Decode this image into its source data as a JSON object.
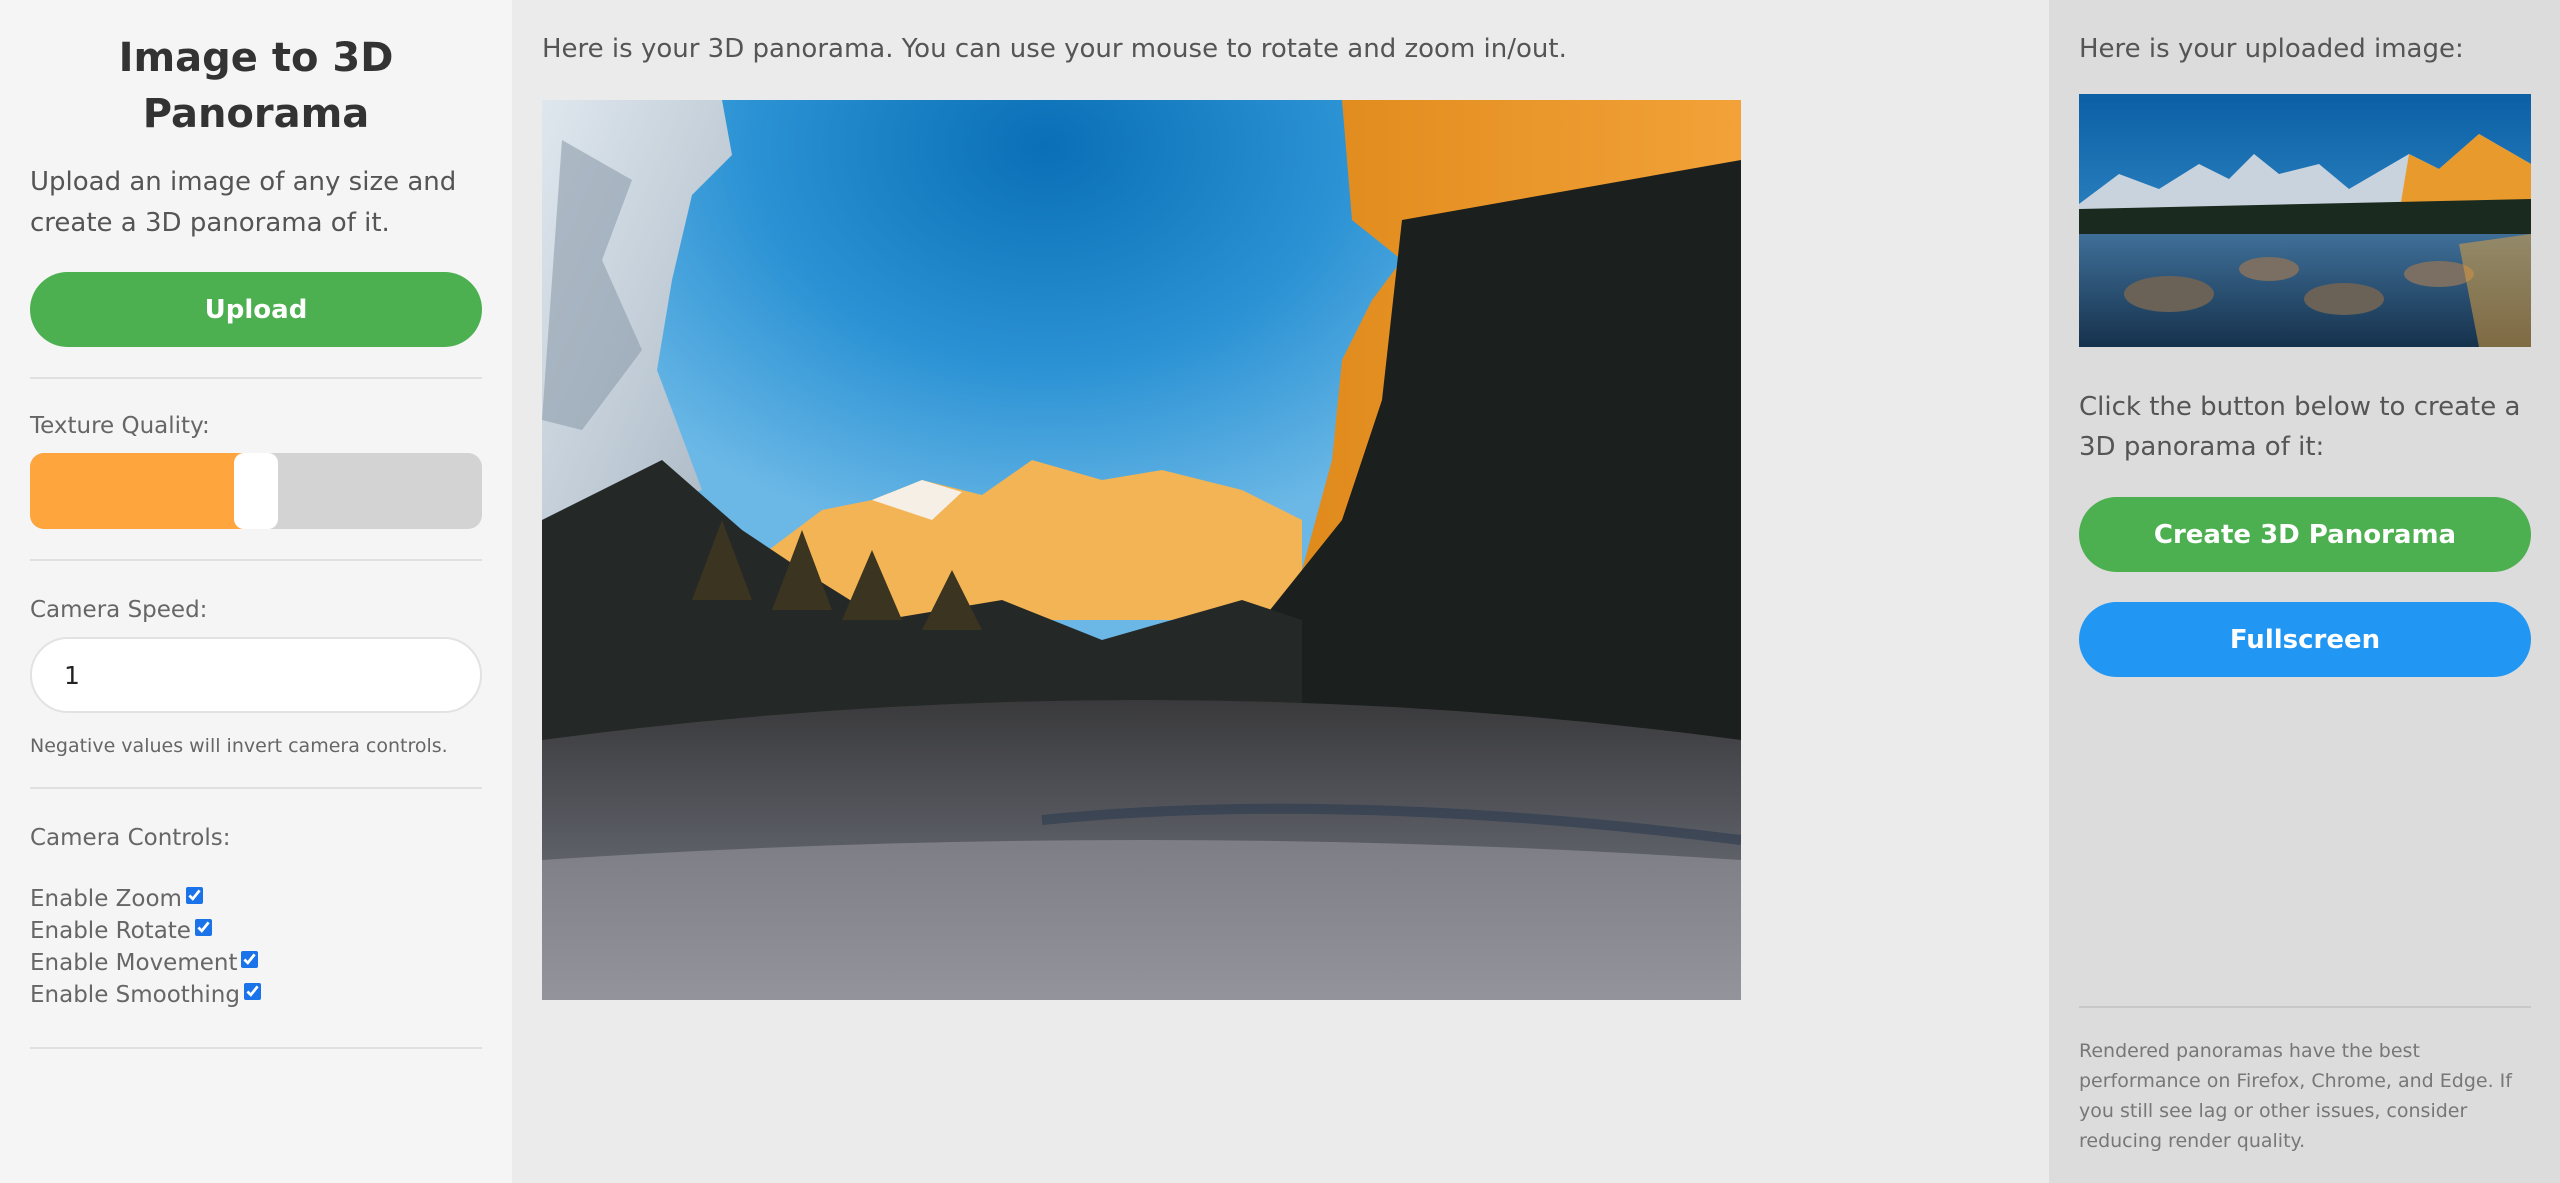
{
  "sidebar": {
    "title": "Image to 3D Panorama",
    "intro": "Upload an image of any size and create a 3D panorama of it.",
    "upload_label": "Upload",
    "texture_quality_label": "Texture Quality:",
    "texture_quality_value": 0.5,
    "camera_speed_label": "Camera Speed:",
    "camera_speed_value": "1",
    "camera_speed_hint": "Negative values will invert camera controls.",
    "camera_controls_label": "Camera Controls:",
    "controls": [
      {
        "label": "Enable Zoom",
        "checked": true
      },
      {
        "label": "Enable Rotate",
        "checked": true
      },
      {
        "label": "Enable Movement",
        "checked": true
      },
      {
        "label": "Enable Smoothing",
        "checked": true
      }
    ]
  },
  "main": {
    "caption": "Here is your 3D panorama. You can use your mouse to rotate and zoom in/out."
  },
  "right": {
    "caption": "Here is your uploaded image:",
    "instruction": "Click the button below to create a 3D panorama of it:",
    "create_label": "Create 3D Panorama",
    "fullscreen_label": "Fullscreen",
    "footnote": "Rendered panoramas have the best performance on Firefox, Chrome, and Edge. If you still see lag or other issues, consider reducing render quality."
  },
  "colors": {
    "upload": "#4caf50",
    "create": "#4caf50",
    "fullscreen": "#2196f3",
    "slider_fill": "#ffa53d",
    "slider_track": "#d3d3d3"
  }
}
